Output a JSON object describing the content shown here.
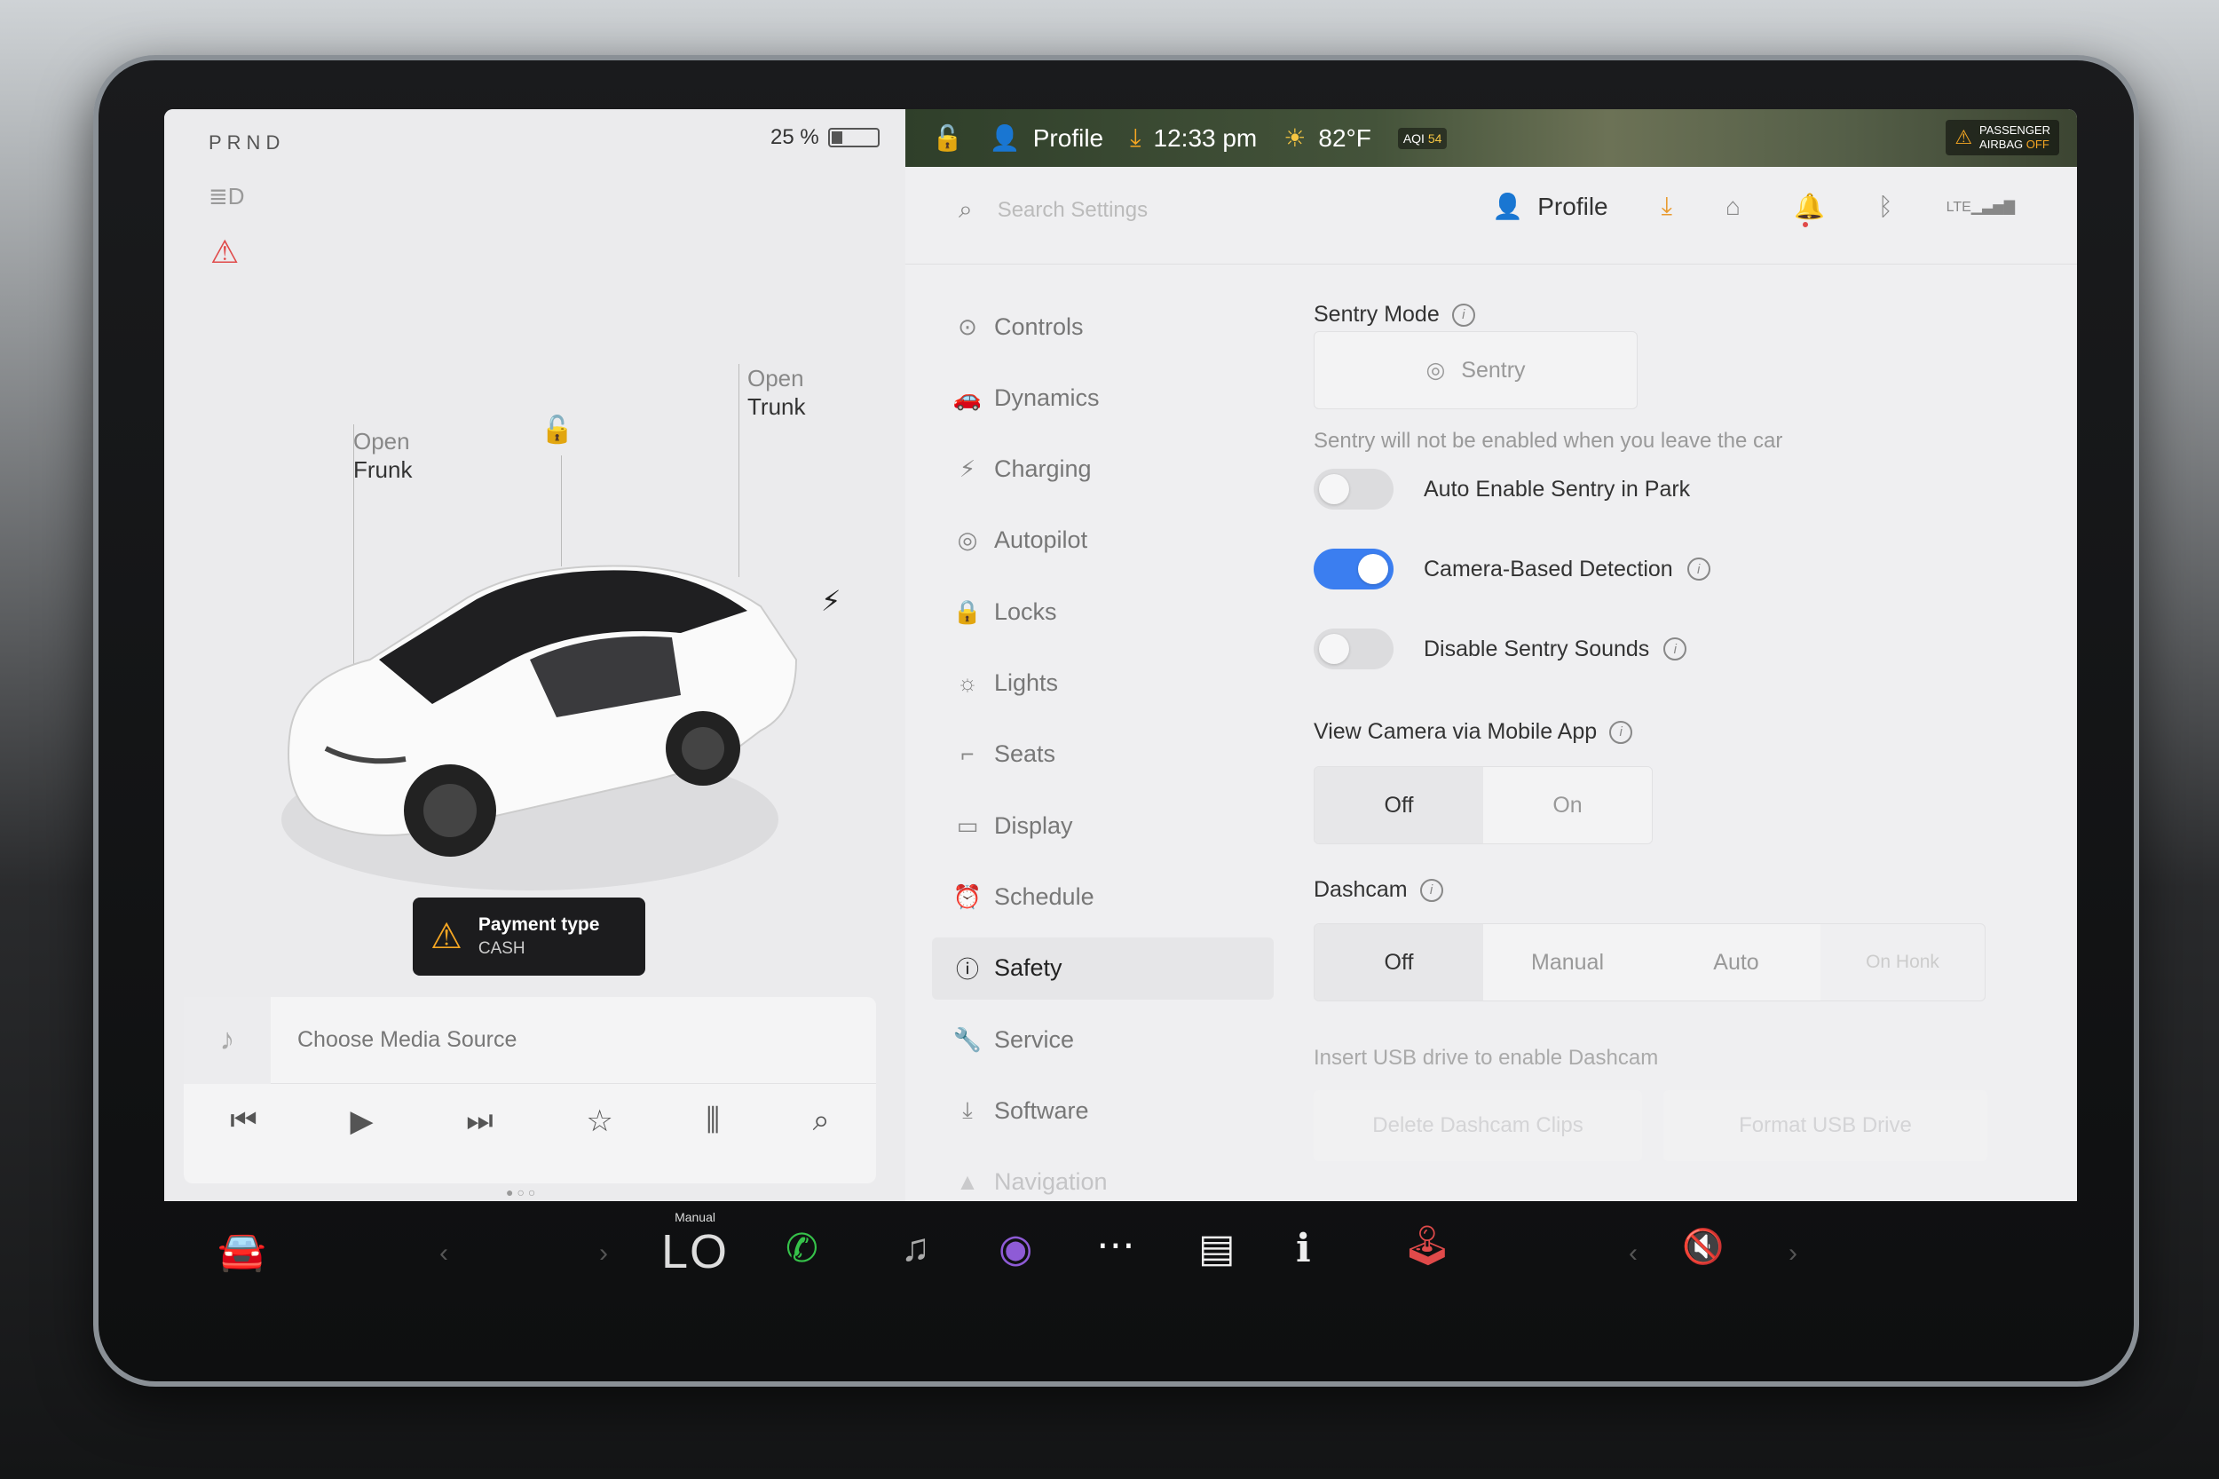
{
  "left": {
    "gear": "PRND",
    "battery_pct": "25 %",
    "battery_level": 0.25,
    "frunk_label_1": "Open",
    "frunk_label_2": "Frunk",
    "trunk_label_1": "Open",
    "trunk_label_2": "Trunk",
    "payment_title": "Payment type",
    "payment_value": "CASH",
    "media_source": "Choose Media Source"
  },
  "topbar": {
    "profile": "Profile",
    "time": "12:33 pm",
    "temp": "82°F",
    "aqi_label": "AQI",
    "aqi_value": "54",
    "airbag_line1": "PASSENGER",
    "airbag_line2_a": "AIRBAG",
    "airbag_line2_b": "OFF"
  },
  "header": {
    "search_placeholder": "Search Settings",
    "profile": "Profile",
    "lte": "LTE"
  },
  "nav": [
    {
      "label": "Controls",
      "icon": "toggle-icon"
    },
    {
      "label": "Dynamics",
      "icon": "car-icon"
    },
    {
      "label": "Charging",
      "icon": "bolt-icon"
    },
    {
      "label": "Autopilot",
      "icon": "steering-wheel-icon"
    },
    {
      "label": "Locks",
      "icon": "lock-icon"
    },
    {
      "label": "Lights",
      "icon": "sun-icon"
    },
    {
      "label": "Seats",
      "icon": "seat-icon"
    },
    {
      "label": "Display",
      "icon": "display-icon"
    },
    {
      "label": "Schedule",
      "icon": "alarm-icon"
    },
    {
      "label": "Safety",
      "icon": "alert-circle-icon"
    },
    {
      "label": "Service",
      "icon": "wrench-icon"
    },
    {
      "label": "Software",
      "icon": "download-icon"
    },
    {
      "label": "Navigation",
      "icon": "navigation-icon"
    }
  ],
  "content": {
    "sentry_mode_title": "Sentry Mode",
    "sentry_button": "Sentry",
    "sentry_note": "Sentry will not be enabled when you leave the car",
    "auto_enable": "Auto Enable Sentry in Park",
    "camera_detection": "Camera-Based Detection",
    "disable_sounds": "Disable Sentry Sounds",
    "view_camera_title": "View Camera via Mobile App",
    "view_camera_off": "Off",
    "view_camera_on": "On",
    "dashcam_title": "Dashcam",
    "dashcam_off": "Off",
    "dashcam_manual": "Manual",
    "dashcam_auto": "Auto",
    "dashcam_onhonk": "On Honk",
    "usb_note": "Insert USB drive to enable Dashcam",
    "delete_clips": "Delete Dashcam Clips",
    "format_usb": "Format USB Drive"
  },
  "dock": {
    "climate_mode": "Manual",
    "climate_temp": "LO"
  }
}
